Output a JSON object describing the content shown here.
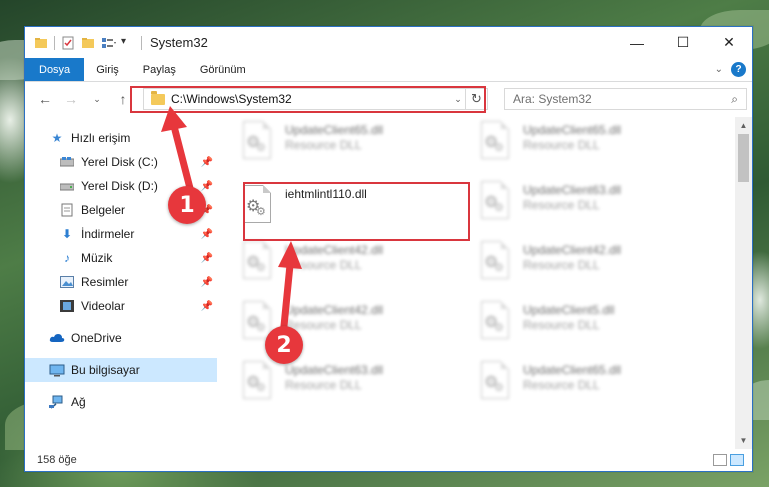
{
  "window": {
    "title": "System32"
  },
  "window_controls": {
    "minimize": "—",
    "maximize": "☐",
    "close": "✕"
  },
  "ribbon": {
    "tabs": [
      "Dosya",
      "Giriş",
      "Paylaş",
      "Görünüm"
    ],
    "help": "?"
  },
  "navigation": {
    "address": "C:\\Windows\\System32",
    "search_placeholder": "Ara: System32"
  },
  "sidebar": {
    "quick_access": "Hızlı erişim",
    "pinned": [
      {
        "label": "Yerel Disk (C:)",
        "icon": "drive-icon"
      },
      {
        "label": "Yerel Disk (D:)",
        "icon": "drive-icon"
      },
      {
        "label": "Belgeler",
        "icon": "documents-icon"
      },
      {
        "label": "İndirmeler",
        "icon": "downloads-icon"
      },
      {
        "label": "Müzik",
        "icon": "music-icon"
      },
      {
        "label": "Resimler",
        "icon": "pictures-icon"
      },
      {
        "label": "Videolar",
        "icon": "videos-icon"
      }
    ],
    "onedrive": "OneDrive",
    "this_pc": "Bu bilgisayar",
    "network": "Ağ"
  },
  "files": {
    "left_column": [
      {
        "name": "UpdateClient65.dll",
        "desc": "Resource DLL",
        "blurred": true
      },
      {
        "name": "iehtmlintl110.dll",
        "desc": "",
        "blurred": false
      },
      {
        "name": "UpdateClient42.dll",
        "desc": "Resource DLL",
        "blurred": true
      },
      {
        "name": "UpdateClient42.dll",
        "desc": "Resource DLL",
        "blurred": true
      },
      {
        "name": "UpdateClient63.dll",
        "desc": "Resource DLL",
        "blurred": true
      }
    ],
    "right_column": [
      {
        "name": "UpdateClient65.dll",
        "desc": "Resource DLL",
        "blurred": true
      },
      {
        "name": "UpdateClient63.dll",
        "desc": "Resource DLL",
        "blurred": true
      },
      {
        "name": "UpdateClient42.dll",
        "desc": "Resource DLL",
        "blurred": true
      },
      {
        "name": "UpdateClient5.dll",
        "desc": "Resource DLL",
        "blurred": true
      },
      {
        "name": "UpdateClient65.dll",
        "desc": "Resource DLL",
        "blurred": true
      }
    ]
  },
  "status": {
    "count": "158 öğe"
  },
  "annotations": {
    "step1": "1",
    "step2": "2",
    "color": "#e7373c"
  }
}
